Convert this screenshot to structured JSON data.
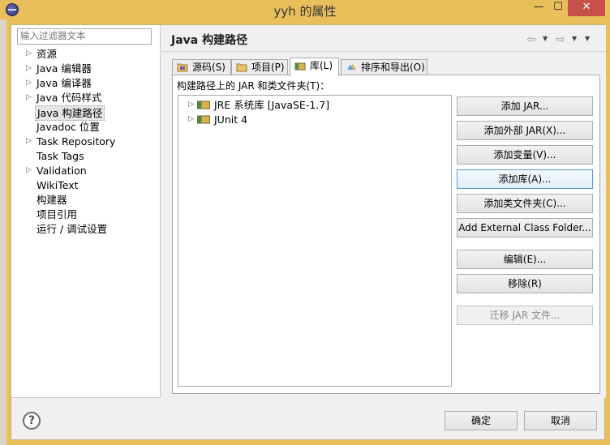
{
  "window": {
    "title": "yyh 的属性",
    "minimize": "—",
    "maximize": "☐",
    "close": "✕"
  },
  "filter": {
    "placeholder": "输入过滤器文本"
  },
  "tree": [
    {
      "label": "资源",
      "expandable": true
    },
    {
      "label": "Java 编辑器",
      "expandable": true
    },
    {
      "label": "Java 编译器",
      "expandable": true
    },
    {
      "label": "Java 代码样式",
      "expandable": true
    },
    {
      "label": "Java 构建路径",
      "expandable": false,
      "selected": true
    },
    {
      "label": "Javadoc 位置",
      "expandable": false
    },
    {
      "label": "Task Repository",
      "expandable": true
    },
    {
      "label": "Task Tags",
      "expandable": false
    },
    {
      "label": "Validation",
      "expandable": true
    },
    {
      "label": "WikiText",
      "expandable": false
    },
    {
      "label": "构建器",
      "expandable": false
    },
    {
      "label": "项目引用",
      "expandable": false
    },
    {
      "label": "运行 / 调试设置",
      "expandable": false
    }
  ],
  "page": {
    "title": "Java 构建路径",
    "nav_back": "⇦",
    "nav_forward": "⇨",
    "nav_menu": "▼"
  },
  "tabs": [
    {
      "label": "源码(S)",
      "icon": "source-folder-icon"
    },
    {
      "label": "项目(P)",
      "icon": "project-icon"
    },
    {
      "label": "库(L)",
      "icon": "library-icon",
      "active": true
    },
    {
      "label": "排序和导出(O)",
      "icon": "order-export-icon"
    }
  ],
  "libraries": {
    "label": "构建路径上的 JAR 和类文件夹(T)：",
    "items": [
      {
        "label": "JRE 系统库 [JavaSE-1.7]"
      },
      {
        "label": "JUnit 4"
      }
    ]
  },
  "buttons": {
    "add_jar": "添加 JAR...",
    "add_external_jar": "添加外部 JAR(X)...",
    "add_variable": "添加变量(V)...",
    "add_library": "添加库(A)...",
    "add_class_folder": "添加类文件夹(C)...",
    "add_external_class_folder": "Add External Class Folder...",
    "edit": "编辑(E)...",
    "remove": "移除(R)",
    "migrate_jar": "迁移 JAR 文件..."
  },
  "footer": {
    "help": "?",
    "ok": "确定",
    "cancel": "取消"
  },
  "colors": {
    "title_bar": "#e9bf5b",
    "close_button": "#c7504b",
    "focus_border": "#4f9ad6"
  }
}
